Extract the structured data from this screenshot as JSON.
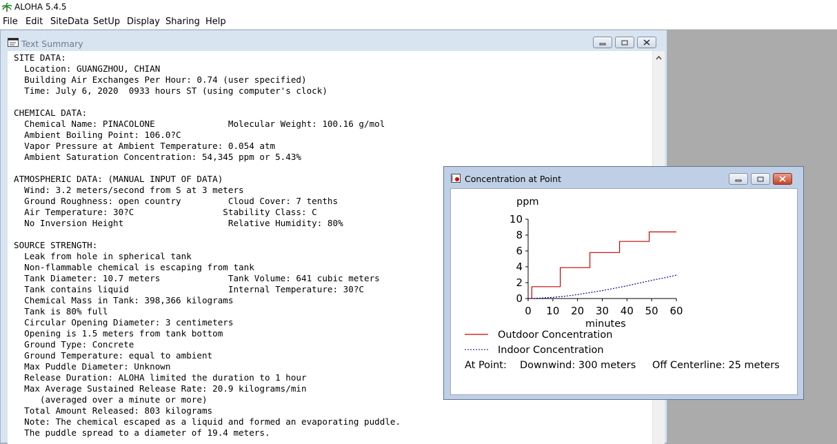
{
  "app": {
    "title": "ALOHA 5.4.5"
  },
  "menu": [
    "File",
    "Edit",
    "SiteData",
    "SetUp",
    "Display",
    "Sharing",
    "Help"
  ],
  "text_summary": {
    "title": "Text Summary",
    "lines": [
      "SITE DATA:",
      "  Location: GUANGZHOU, CHIAN",
      "  Building Air Exchanges Per Hour: 0.74 (user specified)",
      "  Time: July 6, 2020  0933 hours ST (using computer's clock)",
      "",
      "CHEMICAL DATA:",
      "  Chemical Name: PINACOLONE              Molecular Weight: 100.16 g/mol",
      "  Ambient Boiling Point: 106.0?C",
      "  Vapor Pressure at Ambient Temperature: 0.054 atm",
      "  Ambient Saturation Concentration: 54,345 ppm or 5.43%",
      "",
      "ATMOSPHERIC DATA: (MANUAL INPUT OF DATA)",
      "  Wind: 3.2 meters/second from S at 3 meters",
      "  Ground Roughness: open country         Cloud Cover: 7 tenths",
      "  Air Temperature: 30?C                 Stability Class: C",
      "  No Inversion Height                    Relative Humidity: 80%",
      "",
      "SOURCE STRENGTH:",
      "  Leak from hole in spherical tank",
      "  Non-flammable chemical is escaping from tank",
      "  Tank Diameter: 10.7 meters             Tank Volume: 641 cubic meters",
      "  Tank contains liquid                   Internal Temperature: 30?C",
      "  Chemical Mass in Tank: 398,366 kilograms",
      "  Tank is 80% full",
      "  Circular Opening Diameter: 3 centimeters",
      "  Opening is 1.5 meters from tank bottom",
      "  Ground Type: Concrete",
      "  Ground Temperature: equal to ambient",
      "  Max Puddle Diameter: Unknown",
      "  Release Duration: ALOHA limited the duration to 1 hour",
      "  Max Average Sustained Release Rate: 20.9 kilograms/min",
      "     (averaged over a minute or more)",
      "  Total Amount Released: 803 kilograms",
      "  Note: The chemical escaped as a liquid and formed an evaporating puddle.",
      "  The puddle spread to a diameter of 19.4 meters."
    ]
  },
  "concentration_window": {
    "title": "Concentration at Point",
    "at_point_label": "At Point:",
    "downwind": "Downwind: 300 meters",
    "off_centerline": "Off Centerline: 25 meters"
  },
  "chart_data": {
    "type": "line",
    "ylabel": "ppm",
    "xlabel": "minutes",
    "xlim": [
      0,
      60
    ],
    "ylim": [
      0,
      10
    ],
    "x_ticks": [
      0,
      10,
      20,
      30,
      40,
      50,
      60
    ],
    "y_ticks": [
      0,
      2,
      4,
      6,
      8,
      10
    ],
    "series": [
      {
        "name": "Outdoor Concentration",
        "color": "#cc0000",
        "style": "solid",
        "x": [
          0,
          1.5,
          1.5,
          13,
          13,
          25,
          25,
          37,
          37,
          49,
          49,
          60
        ],
        "y": [
          0,
          0,
          1.5,
          1.5,
          3.9,
          3.9,
          5.8,
          5.8,
          7.2,
          7.2,
          8.4,
          8.4
        ]
      },
      {
        "name": "Indoor Concentration",
        "color": "#00008b",
        "style": "dotted",
        "x": [
          0,
          5,
          10,
          15,
          20,
          25,
          30,
          35,
          40,
          45,
          50,
          55,
          60
        ],
        "y": [
          0,
          0.05,
          0.15,
          0.3,
          0.5,
          0.75,
          1.0,
          1.3,
          1.6,
          1.95,
          2.3,
          2.6,
          2.95
        ]
      }
    ]
  }
}
